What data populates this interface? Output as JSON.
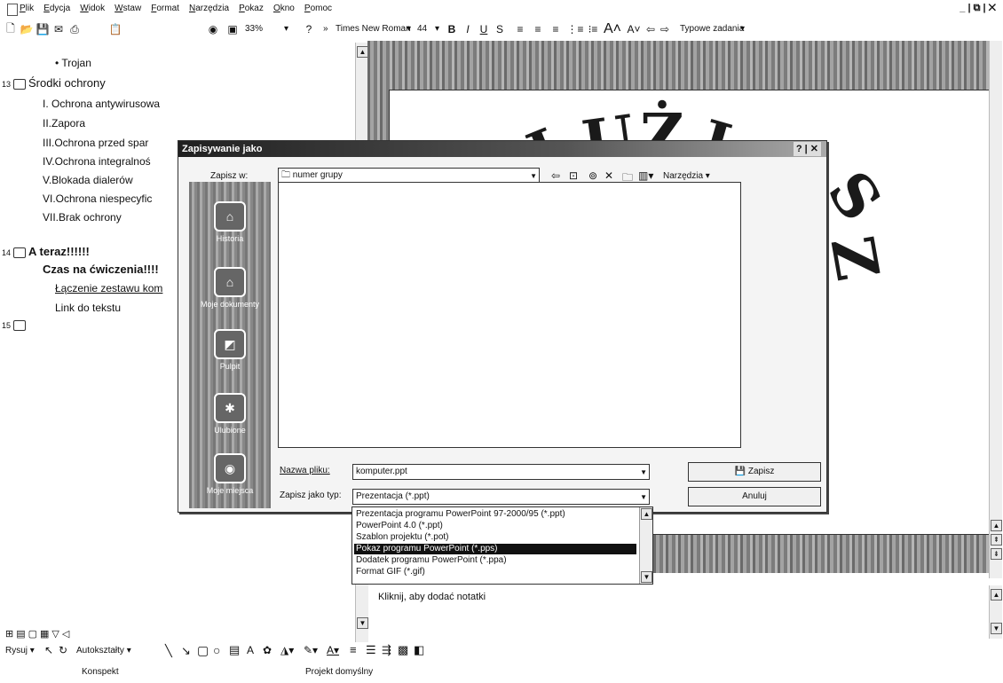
{
  "menu": [
    "Plik",
    "Edycja",
    "Widok",
    "Wstaw",
    "Format",
    "Narzędzia",
    "Pokaz",
    "Okno",
    "Pomoc"
  ],
  "window_controls": "_ | ⧉ | ✕",
  "toolbar": {
    "zoom": "33%",
    "font": "Times New Roman",
    "font_size": "44",
    "tasks": "Typowe zadania"
  },
  "outline": {
    "item_trojan": "• Trojan",
    "slide13_num": "13",
    "slide13_title": "Środki ochrony",
    "items13": [
      "I. Ochrona antywirusowa",
      "II.Zapora",
      "III.Ochrona przed spar",
      "IV.Ochrona integralnoś",
      "V.Blokada dialerów",
      "VI.Ochrona niespecyfic",
      "VII.Brak ochrony"
    ],
    "slide14_num": "14",
    "slide14_title": "A teraz!!!!!!",
    "slide14_sub": "Czas na ćwiczenia!!!!",
    "link1": "Łączenie zestawu kom",
    "link2": "Link do tekstu",
    "slide15_num": "15"
  },
  "dialog": {
    "title": "Zapisywanie jako",
    "help_close": "? | ✕",
    "save_in_label": "Zapisz w:",
    "folder": "numer grupy",
    "tools": "Narzędzia",
    "places": [
      "Historia",
      "Moje dokumenty",
      "Pulpit",
      "Ulubione",
      "Moje miejsca"
    ],
    "filename_label": "Nazwa pliku:",
    "filename_value": "komputer.ppt",
    "type_label": "Zapisz jako typ:",
    "type_value": "Prezentacja (*.ppt)",
    "save_btn": "Zapisz",
    "cancel_btn": "Anuluj",
    "type_options": [
      "Prezentacja programu PowerPoint 97-2000/95 (*.ppt)",
      "PowerPoint 4.0 (*.ppt)",
      "Szablon projektu (*.pot)",
      "Pokaz programu PowerPoint (*.pps)",
      "Dodatek programu PowerPoint (*.ppa)",
      "Format GIF (*.gif)"
    ],
    "selected_option_index": 3
  },
  "slide": {
    "visible_letters": [
      "J",
      "U",
      "Ż",
      "J",
      "S",
      "Z"
    ]
  },
  "notes": "Kliknij, aby dodać notatki",
  "drawing_toolbar": {
    "draw": "Rysuj",
    "autoshapes": "Autokształty"
  },
  "status": {
    "left": "Konspekt",
    "center": "Projekt domyślny"
  }
}
